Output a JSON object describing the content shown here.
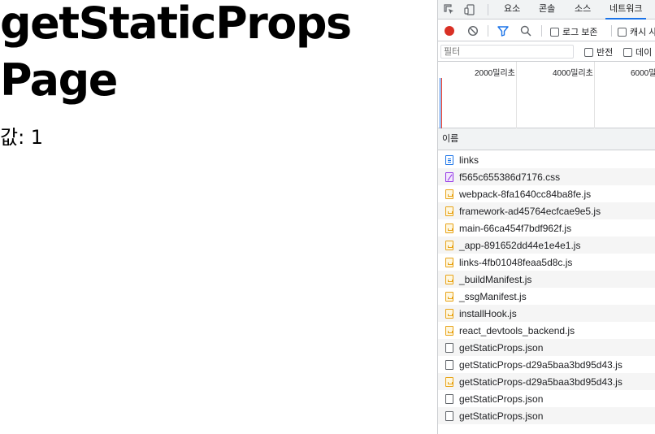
{
  "page": {
    "title": "getStaticProps Page",
    "value_label": "값: 1"
  },
  "devtools": {
    "tabs": [
      {
        "label": "요소"
      },
      {
        "label": "콘솔"
      },
      {
        "label": "소스"
      },
      {
        "label": "네트워크",
        "active": true
      }
    ],
    "toolbar": {
      "preserve_log": "로그 보존",
      "disable_cache": "캐시 사"
    },
    "filter": {
      "placeholder": "필터",
      "invert": "반전",
      "data": "데이"
    },
    "overview": {
      "ticks": [
        "2000밀리초",
        "4000밀리초",
        "6000밀"
      ]
    },
    "name_header": "이름",
    "requests": [
      {
        "name": "links",
        "type": "doc"
      },
      {
        "name": "f565c655386d7176.css",
        "type": "css"
      },
      {
        "name": "webpack-8fa1640cc84ba8fe.js",
        "type": "js"
      },
      {
        "name": "framework-ad45764ecfcae9e5.js",
        "type": "js"
      },
      {
        "name": "main-66ca454f7bdf962f.js",
        "type": "js"
      },
      {
        "name": "_app-891652dd44e1e4e1.js",
        "type": "js"
      },
      {
        "name": "links-4fb01048feaa5d8c.js",
        "type": "js"
      },
      {
        "name": "_buildManifest.js",
        "type": "js"
      },
      {
        "name": "_ssgManifest.js",
        "type": "js"
      },
      {
        "name": "installHook.js",
        "type": "js"
      },
      {
        "name": "react_devtools_backend.js",
        "type": "js"
      },
      {
        "name": "getStaticProps.json",
        "type": "json"
      },
      {
        "name": "getStaticProps-d29a5baa3bd95d43.js",
        "type": "json"
      },
      {
        "name": "getStaticProps-d29a5baa3bd95d43.js",
        "type": "js"
      },
      {
        "name": "getStaticProps.json",
        "type": "json"
      },
      {
        "name": "getStaticProps.json",
        "type": "json"
      }
    ],
    "colors": {
      "accent": "#1a73e8",
      "record": "#d93025",
      "border": "#cbcdd1"
    }
  }
}
